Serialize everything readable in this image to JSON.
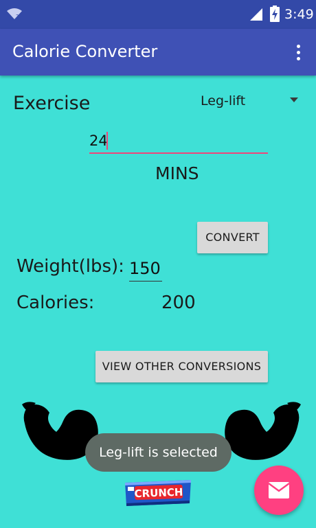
{
  "status_bar": {
    "time": "3:49",
    "icons": [
      "wifi-icon",
      "signal-icon",
      "battery-charging-icon"
    ]
  },
  "app_bar": {
    "title": "Calorie Converter",
    "menu_icon": "more-vert-icon"
  },
  "exercise": {
    "label": "Exercise",
    "selected": "Leg-lift"
  },
  "minutes": {
    "value": "24",
    "unit_label": "MINS"
  },
  "convert_button": {
    "label": "CONVERT"
  },
  "weight": {
    "label": "Weight(lbs):",
    "value": "150"
  },
  "calories": {
    "label": "Calories:",
    "value": "200"
  },
  "view_button": {
    "label": "VIEW OTHER CONVERSIONS"
  },
  "images": {
    "left": "flexed-arm-icon",
    "right": "flexed-arm-icon",
    "candy": "crunch-bar-image",
    "candy_text": "CRUNCH"
  },
  "toast": {
    "message": "Leg-lift is selected"
  },
  "fab": {
    "icon": "email-icon"
  },
  "colors": {
    "background": "#3fe0d6",
    "status_bar": "#3349a8",
    "app_bar": "#3f51b5",
    "accent": "#ff4081",
    "toast": "#5e6a64"
  }
}
